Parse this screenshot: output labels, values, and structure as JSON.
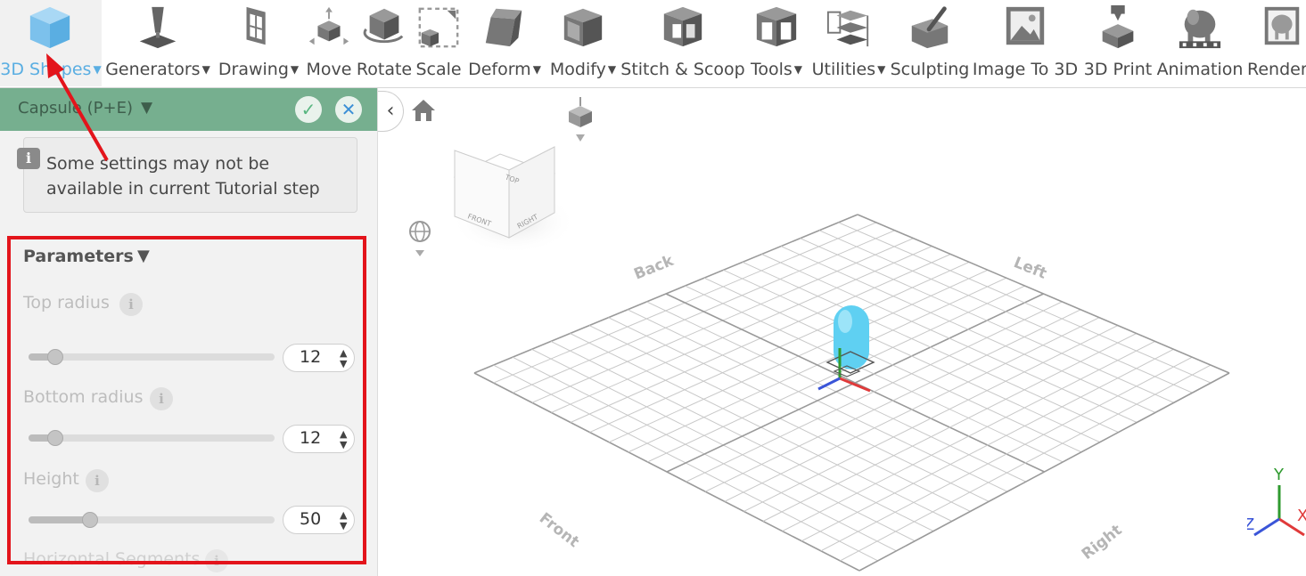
{
  "toolbar": {
    "items": [
      {
        "label": "3D Shapes",
        "dropdown": true,
        "active": true,
        "icon": "cube-icon"
      },
      {
        "label": "Generators",
        "dropdown": true,
        "icon": "generator-icon"
      },
      {
        "label": "Drawing",
        "dropdown": true,
        "icon": "drawing-icon"
      },
      {
        "label": "Move",
        "dropdown": false,
        "icon": "move-icon"
      },
      {
        "label": "Rotate",
        "dropdown": false,
        "icon": "rotate-icon"
      },
      {
        "label": "Scale",
        "dropdown": false,
        "icon": "scale-icon"
      },
      {
        "label": "Deform",
        "dropdown": true,
        "icon": "deform-icon"
      },
      {
        "label": "Modify",
        "dropdown": true,
        "icon": "modify-icon"
      },
      {
        "label": "Stitch & Scoop",
        "dropdown": false,
        "icon": "stitch-icon"
      },
      {
        "label": "Tools",
        "dropdown": true,
        "icon": "tools-icon"
      },
      {
        "label": "Utilities",
        "dropdown": true,
        "icon": "utilities-icon"
      },
      {
        "label": "Sculpting",
        "dropdown": false,
        "icon": "sculpting-icon"
      },
      {
        "label": "Image To 3D",
        "dropdown": false,
        "icon": "image-to-3d-icon"
      },
      {
        "label": "3D Print",
        "dropdown": false,
        "icon": "3d-print-icon"
      },
      {
        "label": "Animation",
        "dropdown": false,
        "icon": "animation-icon"
      },
      {
        "label": "Render",
        "dropdown": false,
        "icon": "render-icon"
      }
    ]
  },
  "panel": {
    "title": "Capsule (P+E)",
    "title_caret": "▼",
    "confirm": "✓",
    "cancel": "✕",
    "notice_icon": "i",
    "notice": "Some settings may not be available in current Tutorial step",
    "params_title": "Parameters",
    "params_caret": "▼",
    "params": [
      {
        "label": "Top radius",
        "value": "12",
        "slider_fraction": 0.11
      },
      {
        "label": "Bottom radius",
        "value": "12",
        "slider_fraction": 0.11
      },
      {
        "label": "Height",
        "value": "50",
        "slider_fraction": 0.25
      }
    ],
    "next_param_label": "Horizontal Segments"
  },
  "viewport": {
    "viewcube": {
      "top": "TOP",
      "front": "FRONT",
      "right": "RIGHT"
    },
    "grid_labels": {
      "back": "Back",
      "left": "Left",
      "front": "Front",
      "right": "Right"
    },
    "axes": {
      "x": "X",
      "y": "Y",
      "z": "Z"
    },
    "colors": {
      "x": "#e03a3a",
      "y": "#2f9a2f",
      "z": "#3a55d8",
      "capsule": "#5fd0f2"
    }
  }
}
